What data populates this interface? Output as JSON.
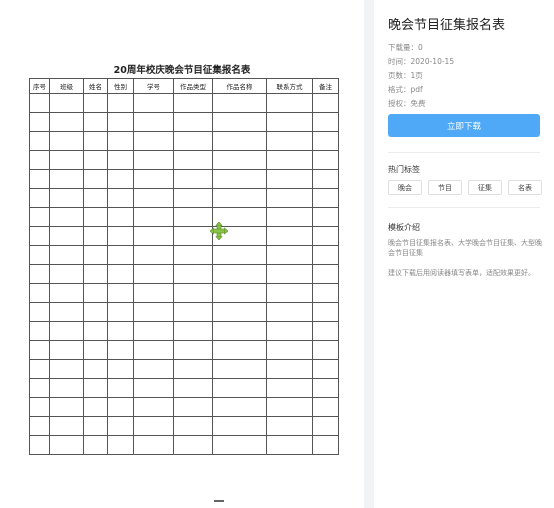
{
  "preview": {
    "doc_title": "20周年校庆晚会节目征集报名表",
    "columns": [
      "序号",
      "班级",
      "姓名",
      "性别",
      "学号",
      "作品类型",
      "作品名称",
      "联系方式",
      "备注"
    ],
    "row_count": 19
  },
  "sidebar": {
    "title": "晚会节目征集报名表",
    "downloads": "下载量：0",
    "time": "时间：2020-10-15",
    "pages": "页数：1页",
    "format": "格式：pdf",
    "license": "授权：免费",
    "download_button": "立即下载",
    "hot_tags_title": "热门标签",
    "tags": [
      "晚会",
      "节目",
      "征集",
      "名表"
    ],
    "intro_title": "模板介绍",
    "intro_text": "晚会节目征集报名表、大学晚会节目征集、大型晚会节目征集",
    "intro_tip": "建议下载后用阅读器填写表单，适配效果更好。"
  },
  "colors": {
    "accent": "#4fa9f7",
    "move_icon": "#8bc34a"
  },
  "icons": {
    "preview_cursor": "move-icon"
  }
}
